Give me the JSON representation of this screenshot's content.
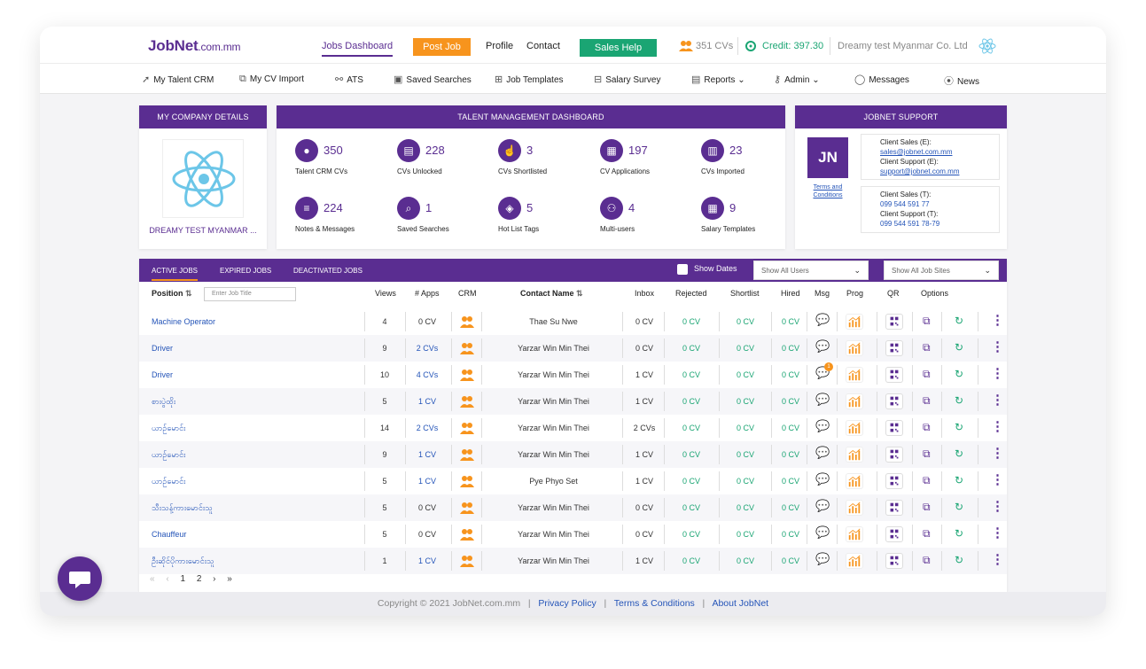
{
  "header": {
    "logo_main": "JobNet",
    "logo_suffix": ".com.mm",
    "nav": {
      "dashboard": "Jobs Dashboard",
      "post_job": "Post Job",
      "profile": "Profile",
      "contact": "Contact",
      "sales_help": "Sales Help"
    },
    "cv_count": "351 CVs",
    "credit": "Credit: 397.30",
    "company": "Dreamy test Myanmar Co. Ltd"
  },
  "subnav": {
    "talent_crm": "My Talent CRM",
    "cv_import": "My CV Import",
    "ats": "ATS",
    "saved_searches": "Saved Searches",
    "job_templates": "Job Templates",
    "salary_survey": "Salary Survey",
    "reports": "Reports",
    "admin": "Admin",
    "messages": "Messages",
    "news": "News"
  },
  "company_card": {
    "title": "MY COMPANY DETAILS",
    "name": "DREAMY TEST MYANMAR ..."
  },
  "dashboard_card": {
    "title": "TALENT MANAGEMENT DASHBOARD",
    "stats": [
      {
        "value": "350",
        "label": "Talent CRM CVs"
      },
      {
        "value": "228",
        "label": "CVs Unlocked"
      },
      {
        "value": "3",
        "label": "CVs Shortlisted"
      },
      {
        "value": "197",
        "label": "CV Applications"
      },
      {
        "value": "23",
        "label": "CVs Imported"
      },
      {
        "value": "224",
        "label": "Notes & Messages"
      },
      {
        "value": "1",
        "label": "Saved Searches"
      },
      {
        "value": "5",
        "label": "Hot List Tags"
      },
      {
        "value": "4",
        "label": "Multi-users"
      },
      {
        "value": "9",
        "label": "Salary Templates"
      }
    ]
  },
  "support_card": {
    "title": "JOBNET SUPPORT",
    "initials": "JN",
    "terms_line1": "Terms and",
    "terms_line2": "Conditions",
    "client_sales_e_label": "Client Sales (E):",
    "client_sales_e": "sales@jobnet.com.mm",
    "client_support_e_label": "Client Support (E):",
    "client_support_e": "support@jobnet.com.mm",
    "client_sales_t_label": "Client Sales (T):",
    "client_sales_t": "099 544 591 77",
    "client_support_t_label": "Client Support (T):",
    "client_support_t": "099 544 591 78-79"
  },
  "jobs": {
    "tabs": {
      "active": "ACTIVE JOBS",
      "expired": "EXPIRED JOBS",
      "deactivated": "DEACTIVATED JOBS"
    },
    "show_dates": "Show Dates",
    "users_filter": "Show All Users",
    "sites_filter": "Show All Job Sites",
    "search_placeholder": "Enter Job Title",
    "columns": {
      "position": "Position",
      "views": "Views",
      "apps": "# Apps",
      "crm": "CRM",
      "contact": "Contact Name",
      "inbox": "Inbox",
      "rejected": "Rejected",
      "shortlist": "Shortlist",
      "hired": "Hired",
      "msg": "Msg",
      "prog": "Prog",
      "qr": "QR",
      "options": "Options"
    },
    "rows": [
      {
        "position": "Machine Operator",
        "views": "4",
        "apps": "0 CV",
        "apps_link": false,
        "contact": "Thae Su Nwe",
        "inbox": "0 CV",
        "rejected": "0 CV",
        "shortlist": "0 CV",
        "hired": "0 CV"
      },
      {
        "position": "Driver",
        "views": "9",
        "apps": "2 CVs",
        "apps_link": true,
        "contact": "Yarzar Win Min Thei",
        "inbox": "0 CV",
        "rejected": "0 CV",
        "shortlist": "0 CV",
        "hired": "0 CV"
      },
      {
        "position": "Driver",
        "views": "10",
        "apps": "4 CVs",
        "apps_link": true,
        "contact": "Yarzar Win Min Thei",
        "inbox": "1 CV",
        "rejected": "0 CV",
        "shortlist": "0 CV",
        "hired": "0 CV",
        "msg_badge": "1"
      },
      {
        "position": "စားပွဲထိုး",
        "views": "5",
        "apps": "1 CV",
        "apps_link": true,
        "contact": "Yarzar Win Min Thei",
        "inbox": "1 CV",
        "rejected": "0 CV",
        "shortlist": "0 CV",
        "hired": "0 CV"
      },
      {
        "position": "ယာဉ်မောင်း",
        "views": "14",
        "apps": "2 CVs",
        "apps_link": true,
        "contact": "Yarzar Win Min Thei",
        "inbox": "2 CVs",
        "rejected": "0 CV",
        "shortlist": "0 CV",
        "hired": "0 CV"
      },
      {
        "position": "ယာဉ်မောင်း",
        "views": "9",
        "apps": "1 CV",
        "apps_link": true,
        "contact": "Yarzar Win Min Thei",
        "inbox": "1 CV",
        "rejected": "0 CV",
        "shortlist": "0 CV",
        "hired": "0 CV"
      },
      {
        "position": "ယာဉ်မောင်း",
        "views": "5",
        "apps": "1 CV",
        "apps_link": true,
        "contact": "Pye Phyo Set",
        "inbox": "1 CV",
        "rejected": "0 CV",
        "shortlist": "0 CV",
        "hired": "0 CV"
      },
      {
        "position": "သီးသန့်ကားမောင်းသူ",
        "views": "5",
        "apps": "0 CV",
        "apps_link": false,
        "contact": "Yarzar Win Min Thei",
        "inbox": "0 CV",
        "rejected": "0 CV",
        "shortlist": "0 CV",
        "hired": "0 CV"
      },
      {
        "position": "Chauffeur",
        "views": "5",
        "apps": "0 CV",
        "apps_link": false,
        "contact": "Yarzar Win Min Thei",
        "inbox": "0 CV",
        "rejected": "0 CV",
        "shortlist": "0 CV",
        "hired": "0 CV"
      },
      {
        "position": "ဦးဆိုင်ပိုကားမောင်းသူ",
        "views": "1",
        "apps": "1 CV",
        "apps_link": true,
        "contact": "Yarzar Win Min Thei",
        "inbox": "1 CV",
        "rejected": "0 CV",
        "shortlist": "0 CV",
        "hired": "0 CV"
      }
    ],
    "pager": {
      "first": "«",
      "prev": "‹",
      "page1": "1",
      "page2": "2",
      "next": "›",
      "last": "»"
    }
  },
  "footer": {
    "copyright": "Copyright © 2021 JobNet.com.mm",
    "privacy": "Privacy Policy",
    "terms": "Terms & Conditions",
    "about": "About JobNet"
  },
  "colors": {
    "brand": "#5a2d91",
    "accent": "#f7941d",
    "success": "#1aa573",
    "link": "#2454b8"
  }
}
